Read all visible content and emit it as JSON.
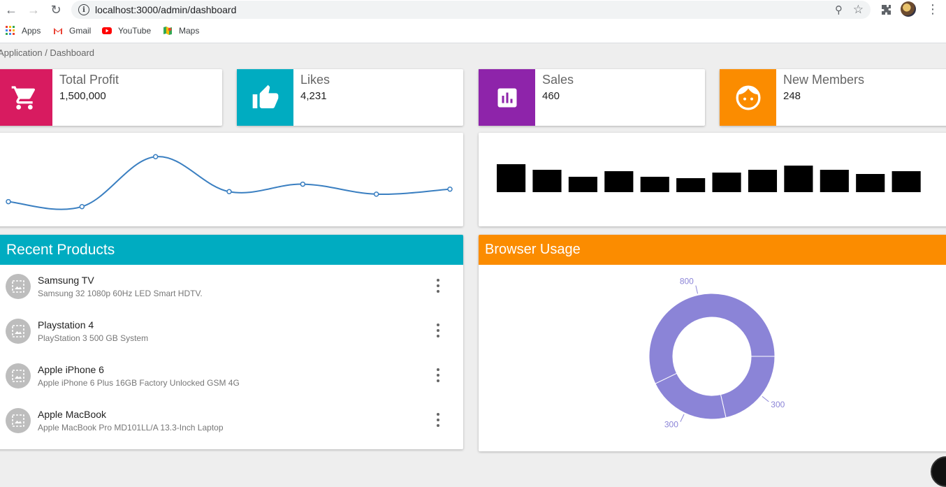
{
  "browser": {
    "url": "localhost:3000/admin/dashboard",
    "bookmarks": [
      {
        "label": "Apps",
        "icon": "apps-grid-icon"
      },
      {
        "label": "Gmail",
        "icon": "gmail-icon"
      },
      {
        "label": "YouTube",
        "icon": "youtube-icon"
      },
      {
        "label": "Maps",
        "icon": "maps-icon"
      }
    ]
  },
  "breadcrumb": "Application / Dashboard",
  "stats": [
    {
      "label": "Total Profit",
      "value": "1,500,000",
      "color": "#d81b60",
      "icon": "cart-icon"
    },
    {
      "label": "Likes",
      "value": "4,231",
      "color": "#00acc1",
      "icon": "thumb-up-icon"
    },
    {
      "label": "Sales",
      "value": "460",
      "color": "#8e24aa",
      "icon": "bar-chart-icon"
    },
    {
      "label": "New Members",
      "value": "248",
      "color": "#fb8c00",
      "icon": "face-icon"
    }
  ],
  "recent_products": {
    "title": "Recent Products",
    "items": [
      {
        "name": "Samsung TV",
        "description": "Samsung 32 1080p 60Hz LED Smart HDTV."
      },
      {
        "name": "Playstation 4",
        "description": "PlayStation 3 500 GB System"
      },
      {
        "name": "Apple iPhone 6",
        "description": "Apple iPhone 6 Plus 16GB Factory Unlocked GSM 4G"
      },
      {
        "name": "Apple MacBook",
        "description": "Apple MacBook Pro MD101LL/A 13.3-Inch Laptop"
      }
    ]
  },
  "browser_usage": {
    "title": "Browser Usage"
  },
  "chart_data": [
    {
      "type": "line",
      "title": "",
      "x": [
        1,
        2,
        3,
        4,
        5,
        6,
        7
      ],
      "series": [
        {
          "values": [
            3,
            2,
            12,
            5,
            6.5,
            4.5,
            5.5
          ]
        }
      ],
      "ylim": [
        0,
        14
      ],
      "grid": false,
      "color": "#3a7fc1"
    },
    {
      "type": "bar",
      "title": "",
      "categories": [
        "1",
        "2",
        "3",
        "4",
        "5",
        "6",
        "7",
        "8",
        "9",
        "10",
        "11",
        "12"
      ],
      "values": [
        10,
        8,
        5.5,
        7.5,
        5.5,
        5,
        7,
        8,
        9.5,
        8,
        6.5,
        7.5
      ],
      "ylim": [
        0,
        10
      ],
      "color": "#000000"
    },
    {
      "type": "pie",
      "title": "",
      "donut": true,
      "values": [
        800,
        300,
        300
      ],
      "labels": [
        "800",
        "300",
        "300"
      ],
      "color": "#8b84d7"
    }
  ]
}
